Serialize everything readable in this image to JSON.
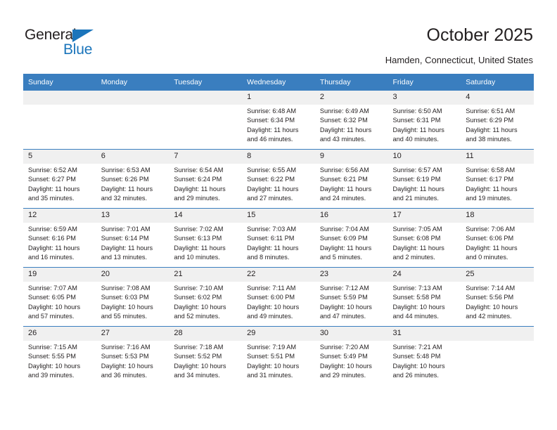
{
  "logo": {
    "word_one": "General",
    "word_two": "Blue",
    "triangle_color": "#1b75bb",
    "text_color": "#231f20"
  },
  "header": {
    "title": "October 2025",
    "subtitle": "Hamden, Connecticut, United States",
    "header_bg": "#3a7ebf",
    "header_text": "#ffffff"
  },
  "calendar": {
    "weekdays": [
      "Sunday",
      "Monday",
      "Tuesday",
      "Wednesday",
      "Thursday",
      "Friday",
      "Saturday"
    ],
    "weeks": [
      [
        {
          "day": "",
          "blank": true
        },
        {
          "day": "",
          "blank": true
        },
        {
          "day": "",
          "blank": true
        },
        {
          "day": "1",
          "sunrise": "Sunrise: 6:48 AM",
          "sunset": "Sunset: 6:34 PM",
          "daylight_1": "Daylight: 11 hours",
          "daylight_2": "and 46 minutes."
        },
        {
          "day": "2",
          "sunrise": "Sunrise: 6:49 AM",
          "sunset": "Sunset: 6:32 PM",
          "daylight_1": "Daylight: 11 hours",
          "daylight_2": "and 43 minutes."
        },
        {
          "day": "3",
          "sunrise": "Sunrise: 6:50 AM",
          "sunset": "Sunset: 6:31 PM",
          "daylight_1": "Daylight: 11 hours",
          "daylight_2": "and 40 minutes."
        },
        {
          "day": "4",
          "sunrise": "Sunrise: 6:51 AM",
          "sunset": "Sunset: 6:29 PM",
          "daylight_1": "Daylight: 11 hours",
          "daylight_2": "and 38 minutes."
        }
      ],
      [
        {
          "day": "5",
          "sunrise": "Sunrise: 6:52 AM",
          "sunset": "Sunset: 6:27 PM",
          "daylight_1": "Daylight: 11 hours",
          "daylight_2": "and 35 minutes."
        },
        {
          "day": "6",
          "sunrise": "Sunrise: 6:53 AM",
          "sunset": "Sunset: 6:26 PM",
          "daylight_1": "Daylight: 11 hours",
          "daylight_2": "and 32 minutes."
        },
        {
          "day": "7",
          "sunrise": "Sunrise: 6:54 AM",
          "sunset": "Sunset: 6:24 PM",
          "daylight_1": "Daylight: 11 hours",
          "daylight_2": "and 29 minutes."
        },
        {
          "day": "8",
          "sunrise": "Sunrise: 6:55 AM",
          "sunset": "Sunset: 6:22 PM",
          "daylight_1": "Daylight: 11 hours",
          "daylight_2": "and 27 minutes."
        },
        {
          "day": "9",
          "sunrise": "Sunrise: 6:56 AM",
          "sunset": "Sunset: 6:21 PM",
          "daylight_1": "Daylight: 11 hours",
          "daylight_2": "and 24 minutes."
        },
        {
          "day": "10",
          "sunrise": "Sunrise: 6:57 AM",
          "sunset": "Sunset: 6:19 PM",
          "daylight_1": "Daylight: 11 hours",
          "daylight_2": "and 21 minutes."
        },
        {
          "day": "11",
          "sunrise": "Sunrise: 6:58 AM",
          "sunset": "Sunset: 6:17 PM",
          "daylight_1": "Daylight: 11 hours",
          "daylight_2": "and 19 minutes."
        }
      ],
      [
        {
          "day": "12",
          "sunrise": "Sunrise: 6:59 AM",
          "sunset": "Sunset: 6:16 PM",
          "daylight_1": "Daylight: 11 hours",
          "daylight_2": "and 16 minutes."
        },
        {
          "day": "13",
          "sunrise": "Sunrise: 7:01 AM",
          "sunset": "Sunset: 6:14 PM",
          "daylight_1": "Daylight: 11 hours",
          "daylight_2": "and 13 minutes."
        },
        {
          "day": "14",
          "sunrise": "Sunrise: 7:02 AM",
          "sunset": "Sunset: 6:13 PM",
          "daylight_1": "Daylight: 11 hours",
          "daylight_2": "and 10 minutes."
        },
        {
          "day": "15",
          "sunrise": "Sunrise: 7:03 AM",
          "sunset": "Sunset: 6:11 PM",
          "daylight_1": "Daylight: 11 hours",
          "daylight_2": "and 8 minutes."
        },
        {
          "day": "16",
          "sunrise": "Sunrise: 7:04 AM",
          "sunset": "Sunset: 6:09 PM",
          "daylight_1": "Daylight: 11 hours",
          "daylight_2": "and 5 minutes."
        },
        {
          "day": "17",
          "sunrise": "Sunrise: 7:05 AM",
          "sunset": "Sunset: 6:08 PM",
          "daylight_1": "Daylight: 11 hours",
          "daylight_2": "and 2 minutes."
        },
        {
          "day": "18",
          "sunrise": "Sunrise: 7:06 AM",
          "sunset": "Sunset: 6:06 PM",
          "daylight_1": "Daylight: 11 hours",
          "daylight_2": "and 0 minutes."
        }
      ],
      [
        {
          "day": "19",
          "sunrise": "Sunrise: 7:07 AM",
          "sunset": "Sunset: 6:05 PM",
          "daylight_1": "Daylight: 10 hours",
          "daylight_2": "and 57 minutes."
        },
        {
          "day": "20",
          "sunrise": "Sunrise: 7:08 AM",
          "sunset": "Sunset: 6:03 PM",
          "daylight_1": "Daylight: 10 hours",
          "daylight_2": "and 55 minutes."
        },
        {
          "day": "21",
          "sunrise": "Sunrise: 7:10 AM",
          "sunset": "Sunset: 6:02 PM",
          "daylight_1": "Daylight: 10 hours",
          "daylight_2": "and 52 minutes."
        },
        {
          "day": "22",
          "sunrise": "Sunrise: 7:11 AM",
          "sunset": "Sunset: 6:00 PM",
          "daylight_1": "Daylight: 10 hours",
          "daylight_2": "and 49 minutes."
        },
        {
          "day": "23",
          "sunrise": "Sunrise: 7:12 AM",
          "sunset": "Sunset: 5:59 PM",
          "daylight_1": "Daylight: 10 hours",
          "daylight_2": "and 47 minutes."
        },
        {
          "day": "24",
          "sunrise": "Sunrise: 7:13 AM",
          "sunset": "Sunset: 5:58 PM",
          "daylight_1": "Daylight: 10 hours",
          "daylight_2": "and 44 minutes."
        },
        {
          "day": "25",
          "sunrise": "Sunrise: 7:14 AM",
          "sunset": "Sunset: 5:56 PM",
          "daylight_1": "Daylight: 10 hours",
          "daylight_2": "and 42 minutes."
        }
      ],
      [
        {
          "day": "26",
          "sunrise": "Sunrise: 7:15 AM",
          "sunset": "Sunset: 5:55 PM",
          "daylight_1": "Daylight: 10 hours",
          "daylight_2": "and 39 minutes."
        },
        {
          "day": "27",
          "sunrise": "Sunrise: 7:16 AM",
          "sunset": "Sunset: 5:53 PM",
          "daylight_1": "Daylight: 10 hours",
          "daylight_2": "and 36 minutes."
        },
        {
          "day": "28",
          "sunrise": "Sunrise: 7:18 AM",
          "sunset": "Sunset: 5:52 PM",
          "daylight_1": "Daylight: 10 hours",
          "daylight_2": "and 34 minutes."
        },
        {
          "day": "29",
          "sunrise": "Sunrise: 7:19 AM",
          "sunset": "Sunset: 5:51 PM",
          "daylight_1": "Daylight: 10 hours",
          "daylight_2": "and 31 minutes."
        },
        {
          "day": "30",
          "sunrise": "Sunrise: 7:20 AM",
          "sunset": "Sunset: 5:49 PM",
          "daylight_1": "Daylight: 10 hours",
          "daylight_2": "and 29 minutes."
        },
        {
          "day": "31",
          "sunrise": "Sunrise: 7:21 AM",
          "sunset": "Sunset: 5:48 PM",
          "daylight_1": "Daylight: 10 hours",
          "daylight_2": "and 26 minutes."
        },
        {
          "day": "",
          "blank": true
        }
      ]
    ]
  }
}
